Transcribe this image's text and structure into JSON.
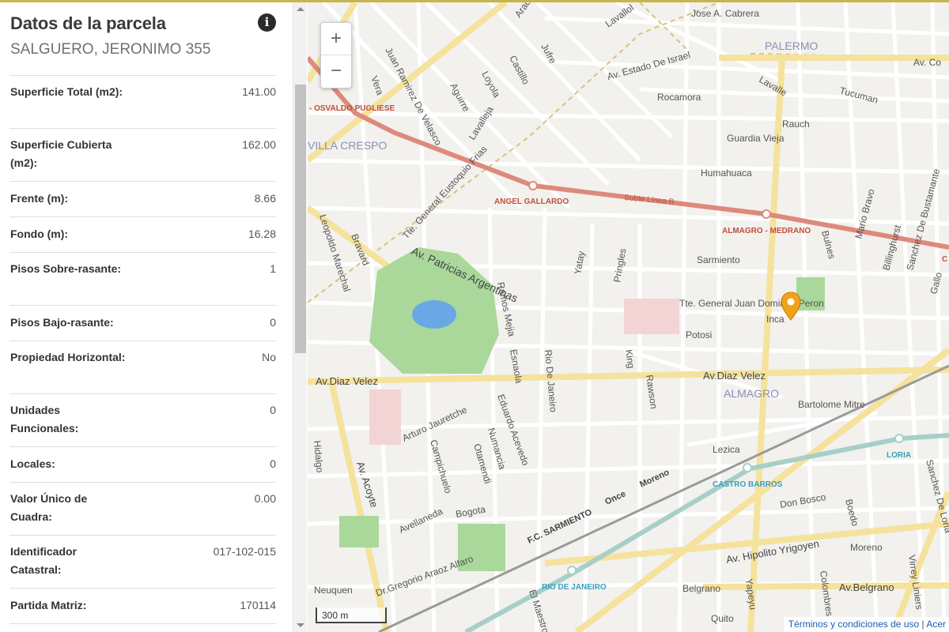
{
  "panel": {
    "title": "Datos de la parcela",
    "subtitle": "SALGUERO, JERONIMO 355",
    "info_icon": "info-circle-icon",
    "rows": [
      {
        "label": "Superficie Total (m2):",
        "value": "141.00"
      },
      {
        "label": "Superficie Cubierta (m2):",
        "value": "162.00"
      },
      {
        "label": "Frente (m):",
        "value": "8.66"
      },
      {
        "label": "Fondo (m):",
        "value": "16.28"
      },
      {
        "label": "Pisos Sobre-rasante:",
        "value": "1"
      },
      {
        "label": "Pisos Bajo-rasante:",
        "value": "0"
      },
      {
        "label": "Propiedad Horizontal:",
        "value": "No"
      },
      {
        "label": "Unidades Funcionales:",
        "value": "0"
      },
      {
        "label": "Locales:",
        "value": "0"
      },
      {
        "label": "Valor Único de Cuadra:",
        "value": "0.00"
      },
      {
        "label": "Identificador Catastral:",
        "value": "017-102-015"
      },
      {
        "label": "Partida Matriz:",
        "value": "170114"
      }
    ]
  },
  "map": {
    "zoom_in": "+",
    "zoom_out": "−",
    "scale_label": "300 m",
    "attribution": {
      "terms": "Términos y condiciones de uso",
      "sep": "|",
      "more": "Acer"
    },
    "marker_icon": "map-pin-icon",
    "colors": {
      "subway_b": "#dd8a7c",
      "subway_a": "#a7cfc8",
      "park": "#a9d89a",
      "main_road": "#f5e29c",
      "railway": "#9a9a9a"
    },
    "neighborhoods": [
      "PALERMO",
      "VILLA CRESPO",
      "ALMAGRO"
    ],
    "stations": [
      "ANGEL GALLARDO",
      "ALMAGRO - MEDRANO",
      "CASTRO BARROS",
      "LORIA",
      "RIO DE JANEIRO"
    ],
    "lines": [
      "Subte Línea B",
      "F.C. SARMIENTO",
      "Once",
      "Moreno"
    ],
    "places": [
      "- OSVALDO PUGLIESE",
      "C"
    ],
    "streets": {
      "jose_a_cabrera": "Jose A. Cabrera",
      "estado_israel": "Av. Estado De Israel",
      "cordoba": "Av. Co",
      "lavalle": "Lavalle",
      "tucuman": "Tucuman",
      "rocamora": "Rocamora",
      "rauch": "Rauch",
      "guardia_vieja": "Guardia Vieja",
      "humahuaca": "Humahuaca",
      "araoz": "Araoz",
      "vera": "Vera",
      "ramirez_velasco": "Juan Ramirez De Velasco",
      "aguirre": "Aguirre",
      "loyola": "Loyola",
      "castillo": "Castillo",
      "jufre": "Jufre",
      "lavallol": "Lavallol",
      "lavallej": "Lavalleja",
      "frias": "Tte. General Eustoquio Frias",
      "leopoldo_marechal": "Leopoldo Marechal",
      "bravard": "Bravard",
      "patricias": "Av. Patricias Argentinas",
      "ramos_mejia": "Ramos Mejia",
      "sarmiento": "Sarmiento",
      "peron": "Tte. General Juan Domingo Peron",
      "inca": "Inca",
      "potosi": "Potosi",
      "yatay": "Yatay",
      "pringles": "Pringles",
      "diaz_velez_w": "Av.Diaz Velez",
      "diaz_velez_e": "Av.Diaz Velez",
      "bartolome_mitre": "Bartolome Mitre",
      "king": "King",
      "rawson": "Rawson",
      "rio_janeiro_st": "Rio De Janeiro",
      "esnaola": "Esnaola",
      "arturo_jauretche": "Arturo Jauretche",
      "eduardo_acevedo": "Eduardo Acevedo",
      "campichuelo": "Campichuelo",
      "numancia": "Numancia",
      "otamendi": "Otamendi",
      "hidalgo": "Hidalgo",
      "acoyte": "Av. Acoyte",
      "avellaneda": "Avellaneda",
      "bogota": "Bogota",
      "lezica": "Lezica",
      "don_bosco": "Don Bosco",
      "boedo": "Boedo",
      "yrigoyen": "Av. Hipolito Yrigoyen",
      "moreno": "Moreno",
      "belgrano_w": "Belgrano",
      "belgrano_e": "Av.Belgrano",
      "colombres": "Colombres",
      "virrey": "Virrey Liniers",
      "yapeyu": "Yapeyu",
      "quito": "Quito",
      "maestro": "El Maestro",
      "araoz_alfaro": "Dr.Gregorio Araoz Alfaro",
      "neuquen": "Neuquen",
      "bulnes": "Bulnes",
      "mario_bravo": "Mario Bravo",
      "billinghurst": "Billinghurst",
      "bustamante": "Sanchez De Bustamante",
      "gallo": "Gallo",
      "loria_st": "Sanchez De Loria"
    }
  }
}
